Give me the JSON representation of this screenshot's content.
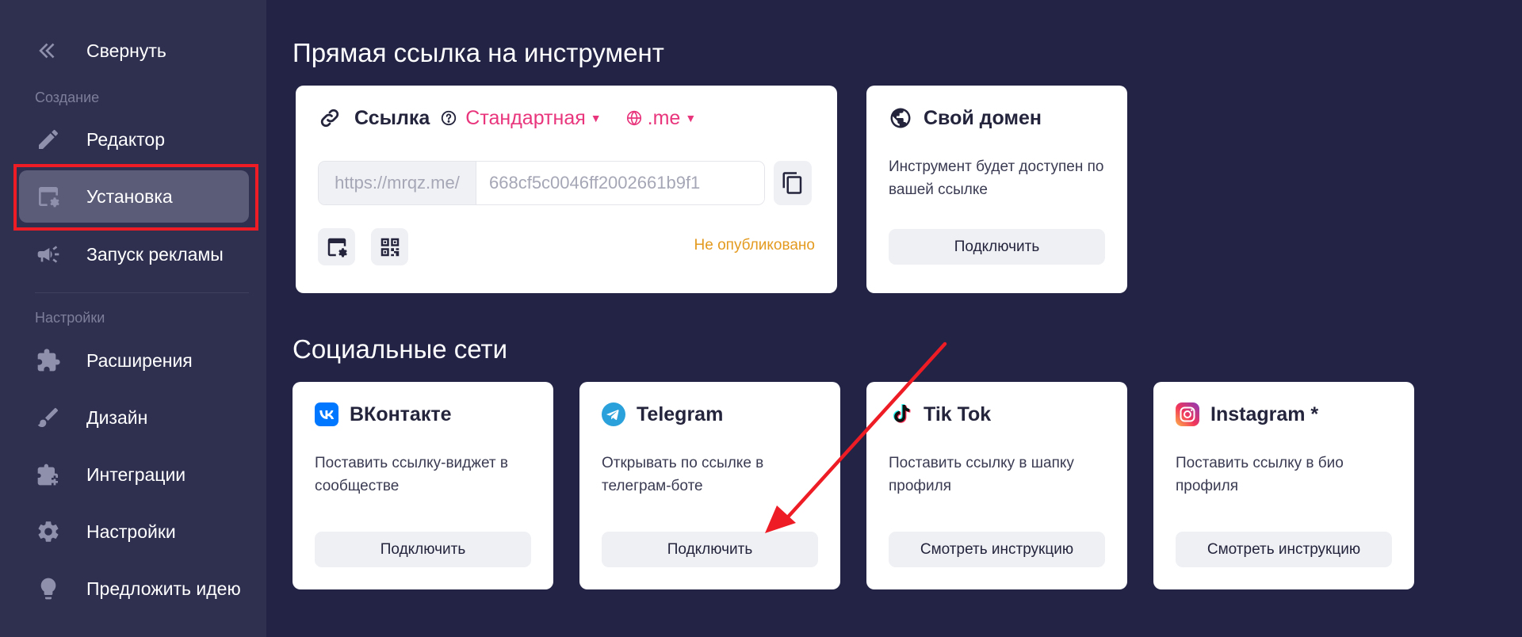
{
  "sidebar": {
    "collapse_label": "Свернуть",
    "section_create": "Создание",
    "section_settings": "Настройки",
    "items": [
      {
        "label": "Редактор",
        "icon": "pencil-icon"
      },
      {
        "label": "Установка",
        "icon": "install-window-gear-icon",
        "active": true
      },
      {
        "label": "Запуск рекламы",
        "icon": "megaphone-icon"
      },
      {
        "label": "Расширения",
        "icon": "puzzle-plus-icon"
      },
      {
        "label": "Дизайн",
        "icon": "brush-icon"
      },
      {
        "label": "Интеграции",
        "icon": "puzzle-add-icon"
      },
      {
        "label": "Настройки",
        "icon": "gear-icon"
      },
      {
        "label": "Предложить идею",
        "icon": "lightbulb-icon"
      }
    ]
  },
  "direct_link": {
    "section_title": "Прямая ссылка на инструмент",
    "card": {
      "title": "Ссылка",
      "type_selected": "Стандартная",
      "domain_selected": ".me",
      "url_prefix": "https://mrqz.me/",
      "url_value": "668cf5c0046ff2002661b9f1",
      "status": "Не опубликовано"
    },
    "own_domain": {
      "title": "Свой домен",
      "description": "Инструмент будет доступен по вашей ссылке",
      "button": "Подключить"
    }
  },
  "social": {
    "section_title": "Социальные сети",
    "cards": [
      {
        "title": "ВКонтакте",
        "description": "Поставить ссылку-виджет в сообществе",
        "button": "Подключить",
        "icon": "vk-icon"
      },
      {
        "title": "Telegram",
        "description": "Открывать по ссылке в телеграм-боте",
        "button": "Подключить",
        "icon": "telegram-icon"
      },
      {
        "title": "Tik Tok",
        "description": "Поставить ссылку в шапку профиля",
        "button": "Смотреть инструкцию",
        "icon": "tiktok-icon"
      },
      {
        "title": "Instagram *",
        "description": "Поставить ссылку в био профиля",
        "button": "Смотреть инструкцию",
        "icon": "instagram-icon"
      }
    ]
  },
  "colors": {
    "background": "#222345",
    "sidebar": "#2f3050",
    "accent_pink": "#e8357c",
    "status_orange": "#e39a1f",
    "annotation_red": "#ee1c25"
  }
}
